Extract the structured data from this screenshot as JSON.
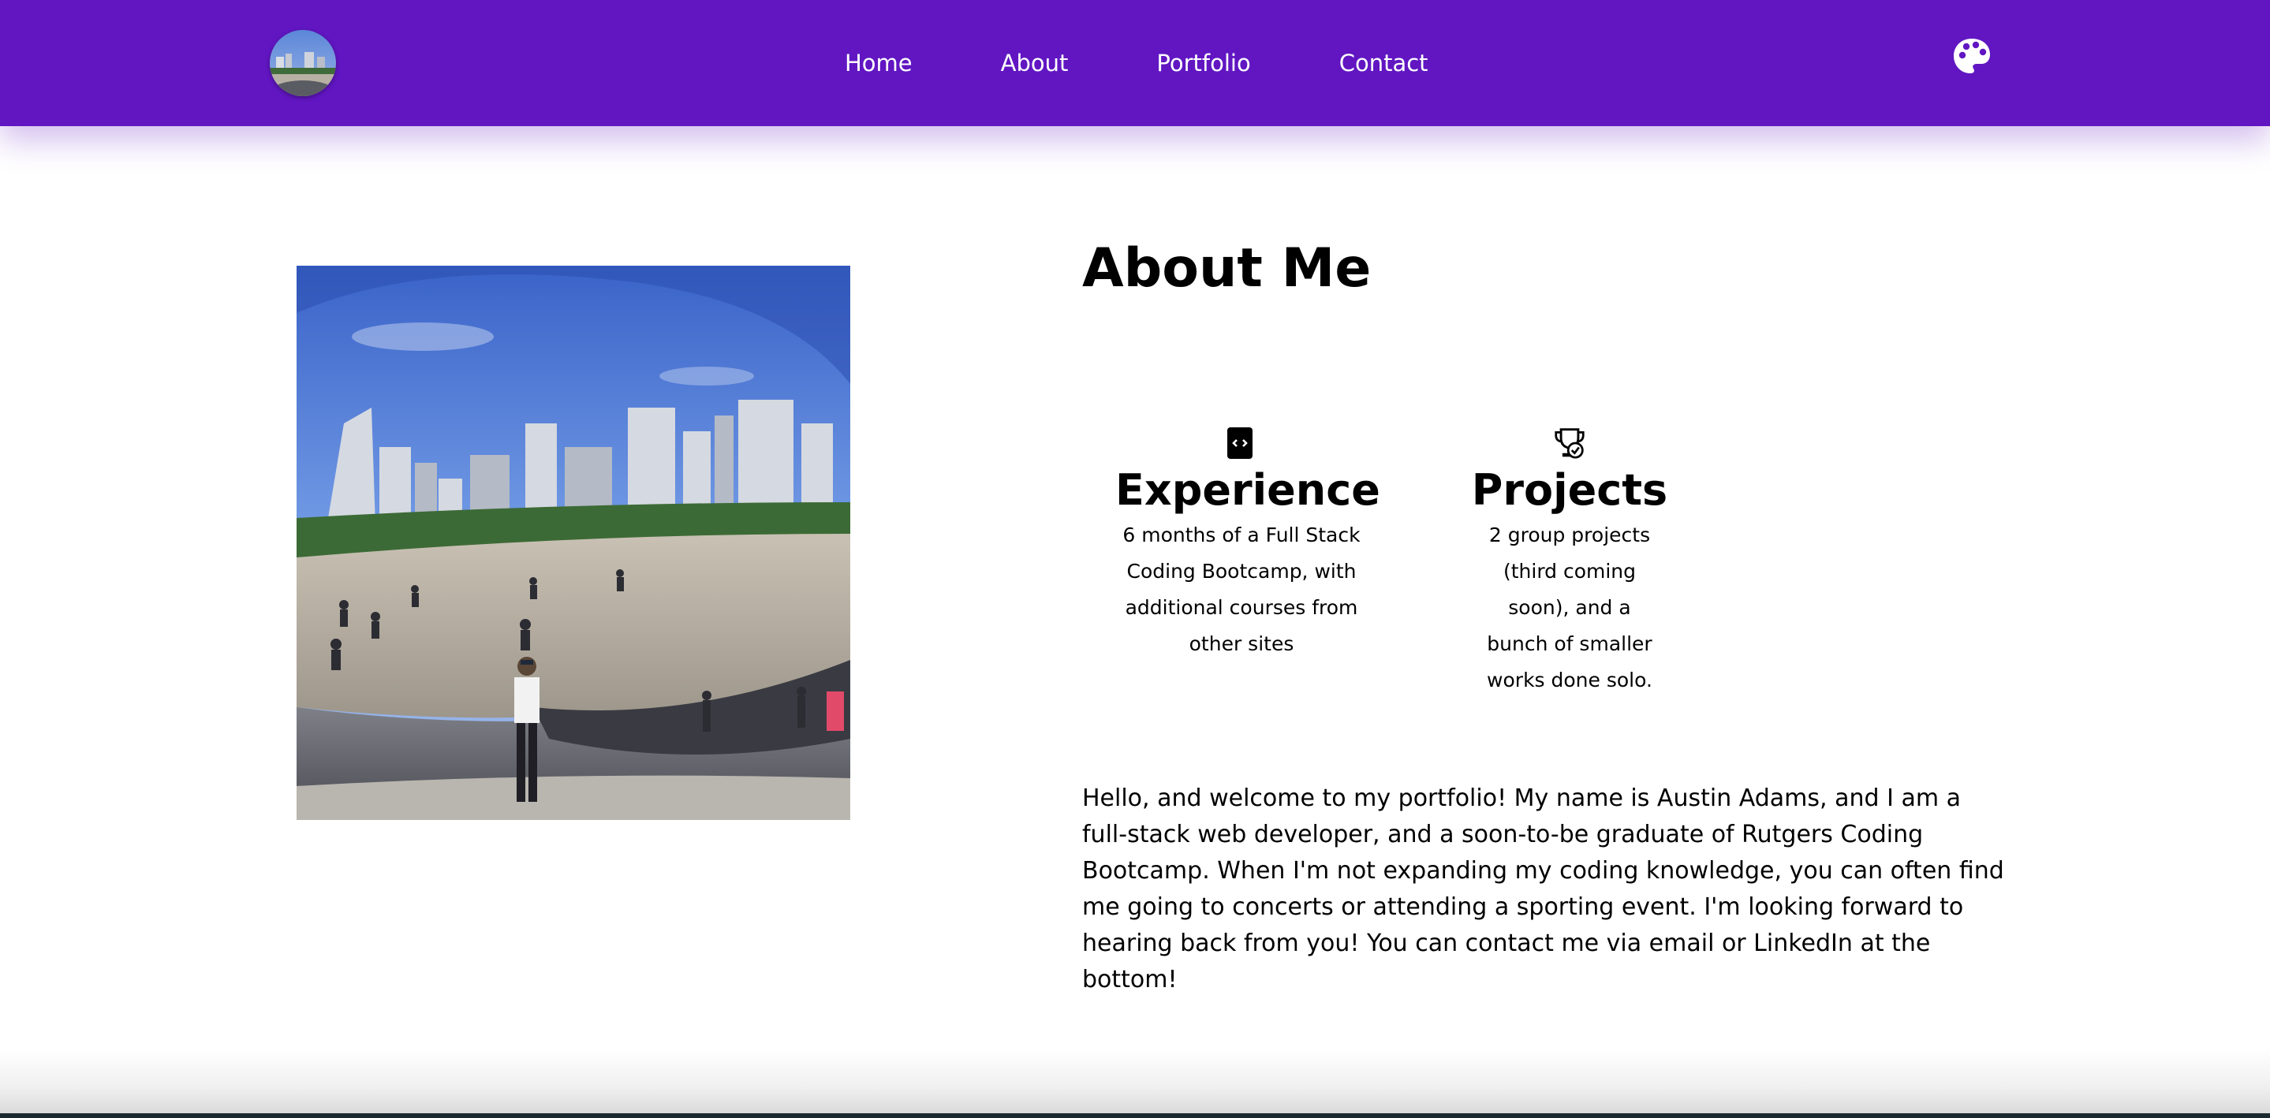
{
  "nav": {
    "links": [
      "Home",
      "About",
      "Portfolio",
      "Contact"
    ],
    "logo_icon": "profile-avatar",
    "theme_icon": "palette-icon",
    "background_color": "#6116c2"
  },
  "about": {
    "title": "About Me",
    "photo_alt_icon": "profile-photo",
    "stats": [
      {
        "icon": "code-file-icon",
        "title": "Experience",
        "description": "6 months of a Full Stack Coding Bootcamp, with additional courses from other sites"
      },
      {
        "icon": "trophy-icon",
        "title": "Projects",
        "description": "2 group projects (third coming soon), and a bunch of smaller works done solo."
      }
    ],
    "bio": "Hello, and welcome to my portfolio! My name is Austin Adams, and I am a full-stack web developer, and a soon-to-be graduate of Rutgers Coding Bootcamp. When I'm not expanding my coding knowledge, you can often find me going to concerts or attending a sporting event. I'm looking forward to hearing back from you! You can contact me via email or LinkedIn at the bottom!"
  }
}
